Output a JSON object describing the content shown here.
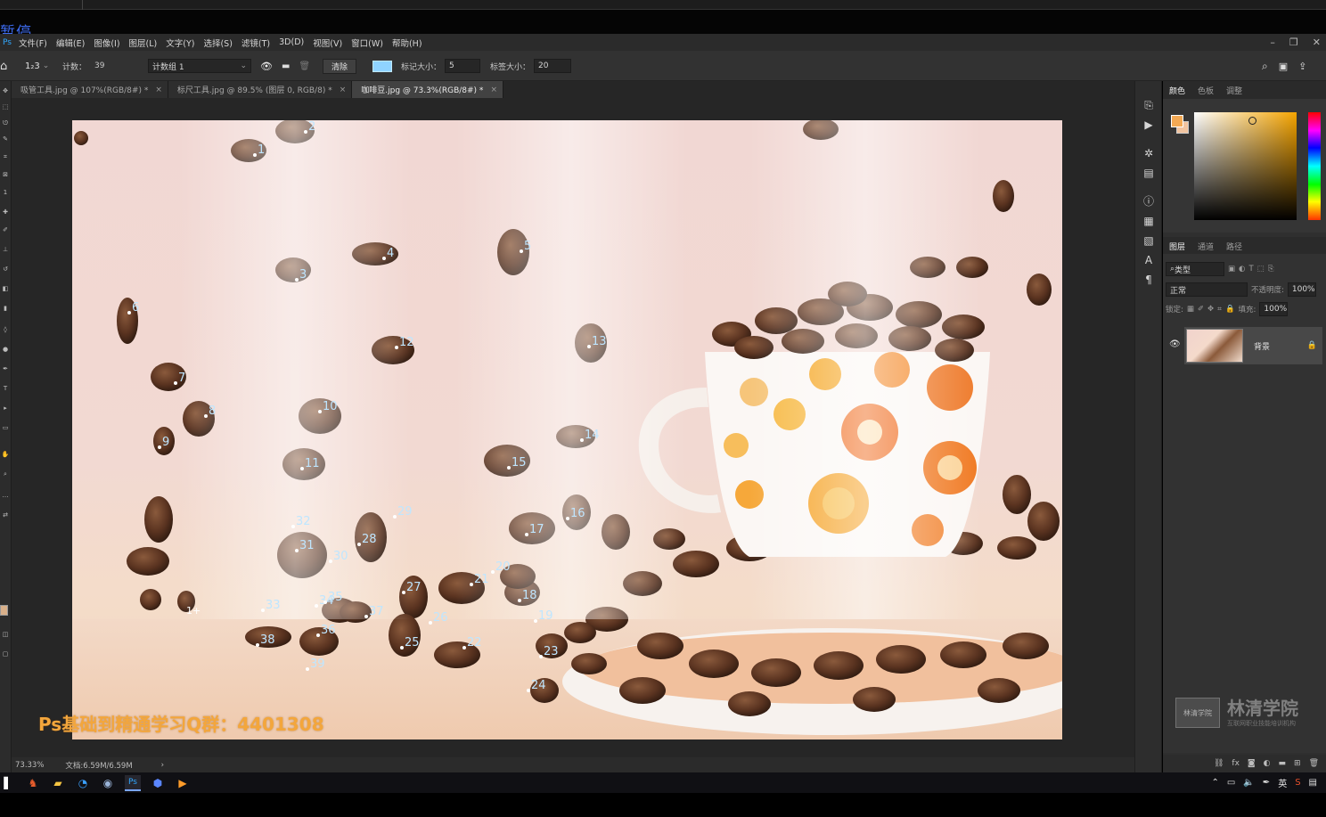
{
  "top": {
    "pause_label": "暂停"
  },
  "menubar": {
    "items": [
      "文件(F)",
      "编辑(E)",
      "图像(I)",
      "图层(L)",
      "文字(Y)",
      "选择(S)",
      "滤镜(T)",
      "3D(D)",
      "视图(V)",
      "窗口(W)",
      "帮助(H)"
    ],
    "window_controls": [
      "minimize-icon",
      "restore-icon",
      "close-icon"
    ]
  },
  "options": {
    "tool_glyph": "1₂3",
    "count_label": "计数：",
    "count_value": "39",
    "group_select": "计数组 1",
    "clear_button": "清除",
    "marker_size_label": "标记大小：",
    "marker_size_value": "5",
    "label_size_label": "标签大小：",
    "label_size_value": "20",
    "swatch_color": "#8fd3ff"
  },
  "tabs": [
    {
      "label": "吸管工具.jpg @ 107%(RGB/8#) *",
      "active": false
    },
    {
      "label": "标尺工具.jpg @ 89.5% (图层 0, RGB/8) *",
      "active": false
    },
    {
      "label": "咖啡豆.jpg @ 73.3%(RGB/8#) *",
      "active": true
    }
  ],
  "canvas": {
    "qq_watermark": "Ps基础到精通学习Q群：4401308",
    "cursor_label": "1+",
    "count_marks": [
      "1",
      "2",
      "3",
      "4",
      "5",
      "6",
      "7",
      "8",
      "9",
      "10",
      "11",
      "12",
      "13",
      "14",
      "15",
      "16",
      "17",
      "18",
      "19",
      "20",
      "21",
      "22",
      "23",
      "24",
      "25",
      "26",
      "27",
      "28",
      "29",
      "30",
      "31",
      "32",
      "33",
      "34",
      "35",
      "36",
      "37",
      "38",
      "39"
    ]
  },
  "status": {
    "zoom": "73.33%",
    "doc_size": "文档:6.59M/6.59M"
  },
  "color_panel": {
    "tabs": [
      "颜色",
      "色板",
      "调整"
    ],
    "foreground": "#f3a954",
    "background": "#f1c4a0"
  },
  "layers_panel": {
    "tabs": [
      "图层",
      "通道",
      "路径"
    ],
    "kind_filter": "类型",
    "blend_mode": "正常",
    "opacity_label": "不透明度:",
    "opacity_value": "100%",
    "lock_label": "锁定:",
    "fill_label": "填充:",
    "fill_value": "100%",
    "layer_name": "背景"
  },
  "brand": {
    "title": "林清学院",
    "badge": "林清学院",
    "slogan": "互联网职业技能培训机构"
  },
  "taskbar": {
    "tray_lang": "英",
    "apps": [
      "start-icon",
      "game-icon",
      "file-explorer-icon",
      "browser-icon",
      "chrome-icon",
      "photoshop-icon",
      "shield-app-icon",
      "media-app-icon"
    ]
  }
}
